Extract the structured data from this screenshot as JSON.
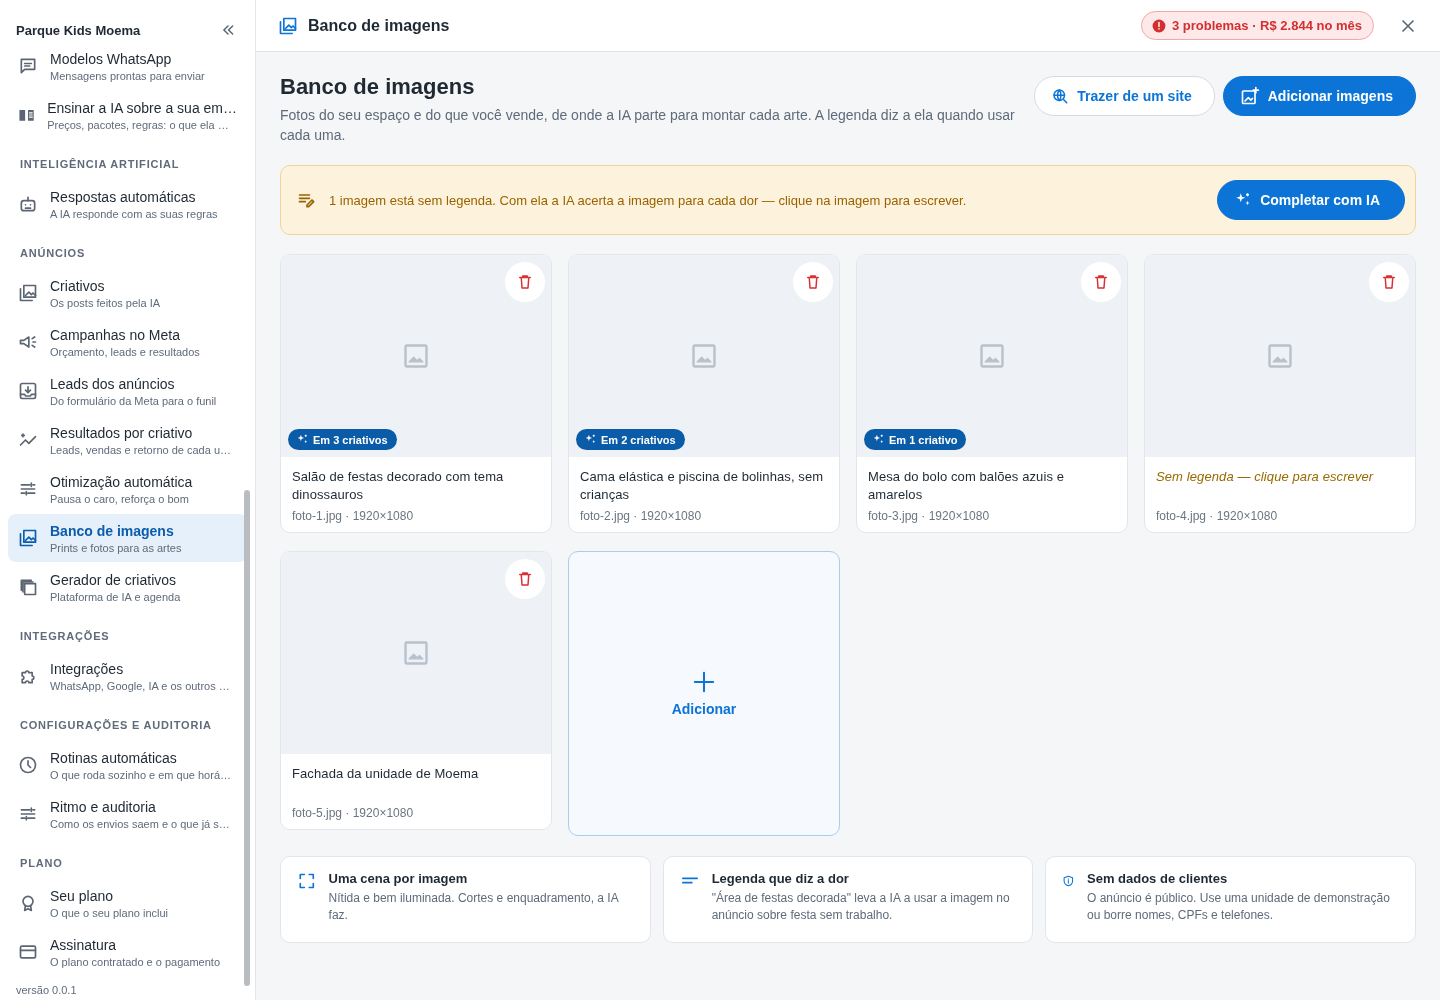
{
  "sidebar": {
    "brand": "Parque Kids Moema",
    "sections": [
      {
        "items": [
          {
            "title": "Modelos WhatsApp",
            "subtitle": "Mensagens prontas para enviar",
            "selected": false
          },
          {
            "title": "Ensinar a IA sobre a sua em…",
            "subtitle": "Preços, pacotes, regras: o que ela …",
            "selected": false
          }
        ]
      },
      {
        "heading": "INTELIGÊNCIA ARTIFICIAL",
        "items": [
          {
            "title": "Respostas automáticas",
            "subtitle": "A IA responde com as suas regras",
            "selected": false
          }
        ]
      },
      {
        "heading": "ANÚNCIOS",
        "items": [
          {
            "title": "Criativos",
            "subtitle": "Os posts feitos pela IA",
            "selected": false
          },
          {
            "title": "Campanhas no Meta",
            "subtitle": "Orçamento, leads e resultados",
            "selected": false
          },
          {
            "title": "Leads dos anúncios",
            "subtitle": "Do formulário da Meta para o funil",
            "selected": false
          },
          {
            "title": "Resultados por criativo",
            "subtitle": "Leads, vendas e retorno de cada u…",
            "selected": false
          },
          {
            "title": "Otimização automática",
            "subtitle": "Pausa o caro, reforça o bom",
            "selected": false
          },
          {
            "title": "Banco de imagens",
            "subtitle": "Prints e fotos para as artes",
            "selected": true
          },
          {
            "title": "Gerador de criativos",
            "subtitle": "Plataforma de IA e agenda",
            "selected": false
          }
        ]
      },
      {
        "heading": "INTEGRAÇÕES",
        "items": [
          {
            "title": "Integrações",
            "subtitle": "WhatsApp, Google, IA e os outros …",
            "selected": false
          }
        ]
      },
      {
        "heading": "CONFIGURAÇÕES E AUDITORIA",
        "items": [
          {
            "title": "Rotinas automáticas",
            "subtitle": "O que roda sozinho e em que horá…",
            "selected": false
          },
          {
            "title": "Ritmo e auditoria",
            "subtitle": "Como os envios saem e o que já s…",
            "selected": false
          }
        ]
      },
      {
        "heading": "PLANO",
        "items": [
          {
            "title": "Seu plano",
            "subtitle": "O que o seu plano inclui",
            "selected": false
          },
          {
            "title": "Assinatura",
            "subtitle": "O plano contratado e o pagamento",
            "selected": false
          }
        ]
      }
    ],
    "version": "versão 0.0.1"
  },
  "header": {
    "title": "Banco de imagens",
    "problems": "3 problemas · R$ 2.844 no mês"
  },
  "page": {
    "title": "Banco de imagens",
    "description": "Fotos do seu espaço e do que você vende, de onde a IA parte para montar cada arte. A legenda diz a ela quando usar cada uma.",
    "buttons": [
      {
        "label": "Trazer de um site",
        "kind": "secondary"
      },
      {
        "label": "Adicionar imagens",
        "kind": "primary"
      }
    ]
  },
  "banner": {
    "text": "1 imagem está sem legenda. Com ela a IA acerta a imagem para cada dor — clique na imagem para escrever.",
    "button": "Completar com IA"
  },
  "images": [
    {
      "kind": "photo",
      "badge": "Em 3 criativos",
      "caption": "Salão de festas decorado com tema dinossauros",
      "captioned": true,
      "file": "foto-1.jpg · 1920×1080"
    },
    {
      "kind": "photo",
      "badge": "Em 2 criativos",
      "caption": "Cama elástica e piscina de bolinhas, sem crianças",
      "captioned": true,
      "file": "foto-2.jpg · 1920×1080"
    },
    {
      "kind": "photo",
      "badge": "Em 1 criativo",
      "caption": "Mesa do bolo com balões azuis e amarelos",
      "captioned": true,
      "file": "foto-3.jpg · 1920×1080"
    },
    {
      "kind": "photo",
      "caption": "Sem legenda — clique para escrever",
      "captioned": false,
      "file": "foto-4.jpg · 1920×1080"
    },
    {
      "kind": "photo",
      "caption": "Fachada da unidade de Moema",
      "captioned": true,
      "file": "foto-5.jpg · 1920×1080"
    },
    {
      "kind": "add",
      "label": "Adicionar"
    }
  ],
  "tips": [
    {
      "title": "Uma cena por imagem",
      "text": "Nítida e bem iluminada. Cortes e enquadramento, a IA faz."
    },
    {
      "title": "Legenda que diz a dor",
      "text": "\"Área de festas decorada\" leva a IA a usar a imagem no anúncio sobre festa sem trabalho."
    },
    {
      "title": "Sem dados de clientes",
      "text": "O anúncio é público. Use uma unidade de demonstração ou borre nomes, CPFs e telefones."
    }
  ]
}
